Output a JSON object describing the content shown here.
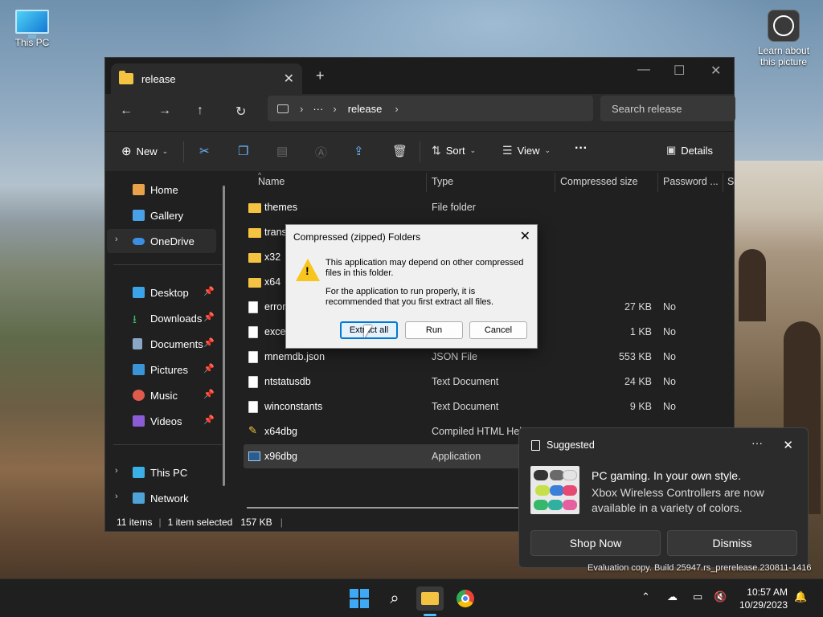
{
  "desktop": {
    "this_pc": "This PC",
    "learn_line1": "Learn about",
    "learn_line2": "this picture",
    "watermark": "Evaluation copy. Build 25947.rs_prerelease.230811-1416"
  },
  "explorer": {
    "tab_title": "release",
    "breadcrumb": {
      "ellipsis": "···",
      "current": "release"
    },
    "search_placeholder": "Search release",
    "commands": {
      "new": "New",
      "sort": "Sort",
      "view": "View",
      "more": "···",
      "details": "Details"
    },
    "nav": [
      {
        "label": "Home",
        "icon": "home-icon",
        "pinned": false,
        "expandable": false
      },
      {
        "label": "Gallery",
        "icon": "gallery-icon",
        "pinned": false,
        "expandable": false
      },
      {
        "label": "OneDrive",
        "icon": "cloud-icon",
        "pinned": false,
        "expandable": true,
        "selected": true
      },
      {
        "label": "Desktop",
        "icon": "desktop-icon",
        "pinned": true
      },
      {
        "label": "Downloads",
        "icon": "download-icon",
        "pinned": true
      },
      {
        "label": "Documents",
        "icon": "documents-icon",
        "pinned": true
      },
      {
        "label": "Pictures",
        "icon": "pictures-icon",
        "pinned": true
      },
      {
        "label": "Music",
        "icon": "music-icon",
        "pinned": true
      },
      {
        "label": "Videos",
        "icon": "videos-icon",
        "pinned": true
      },
      {
        "label": "This PC",
        "icon": "pc-icon",
        "expandable": true
      },
      {
        "label": "Network",
        "icon": "network-icon",
        "expandable": true
      }
    ],
    "columns": [
      "Name",
      "Type",
      "Compressed size",
      "Password ...",
      "Si"
    ],
    "files": [
      {
        "name": "themes",
        "type": "File folder",
        "size": "",
        "password": "",
        "kind": "folder"
      },
      {
        "name": "trans",
        "type": "",
        "size": "",
        "password": "",
        "kind": "folder"
      },
      {
        "name": "x32",
        "type": "",
        "size": "",
        "password": "",
        "kind": "folder"
      },
      {
        "name": "x64",
        "type": "",
        "size": "",
        "password": "",
        "kind": "folder"
      },
      {
        "name": "error",
        "type": "",
        "size": "27 KB",
        "password": "No",
        "kind": "doc"
      },
      {
        "name": "excep",
        "type": "",
        "size": "1 KB",
        "password": "No",
        "kind": "doc"
      },
      {
        "name": "mnemdb.json",
        "type": "JSON File",
        "size": "553 KB",
        "password": "No",
        "kind": "doc"
      },
      {
        "name": "ntstatusdb",
        "type": "Text Document",
        "size": "24 KB",
        "password": "No",
        "kind": "doc"
      },
      {
        "name": "winconstants",
        "type": "Text Document",
        "size": "9 KB",
        "password": "No",
        "kind": "doc"
      },
      {
        "name": "x64dbg",
        "type": "Compiled HTML Hel",
        "size": "",
        "password": "",
        "kind": "chm"
      },
      {
        "name": "x96dbg",
        "type": "Application",
        "size": "",
        "password": "",
        "kind": "app",
        "selected": true
      }
    ],
    "status": {
      "items": "11 items",
      "selected": "1 item selected",
      "size": "157 KB"
    }
  },
  "dialog": {
    "title": "Compressed (zipped) Folders",
    "line1": "This application may depend on other compressed files in this folder.",
    "line2": "For the application to run properly, it is recommended that you first extract all files.",
    "extract": "Extract all",
    "run": "Run",
    "cancel": "Cancel"
  },
  "toast": {
    "header": "Suggested",
    "title": "PC gaming. In your own style.",
    "body": "Xbox Wireless Controllers are now available in a variety of colors.",
    "shop": "Shop Now",
    "dismiss": "Dismiss"
  },
  "taskbar": {
    "time": "10:57 AM",
    "date": "10/29/2023"
  },
  "colors": {
    "accent": "#0078d4",
    "folder": "#f5c342",
    "warning": "#f7c51e"
  }
}
